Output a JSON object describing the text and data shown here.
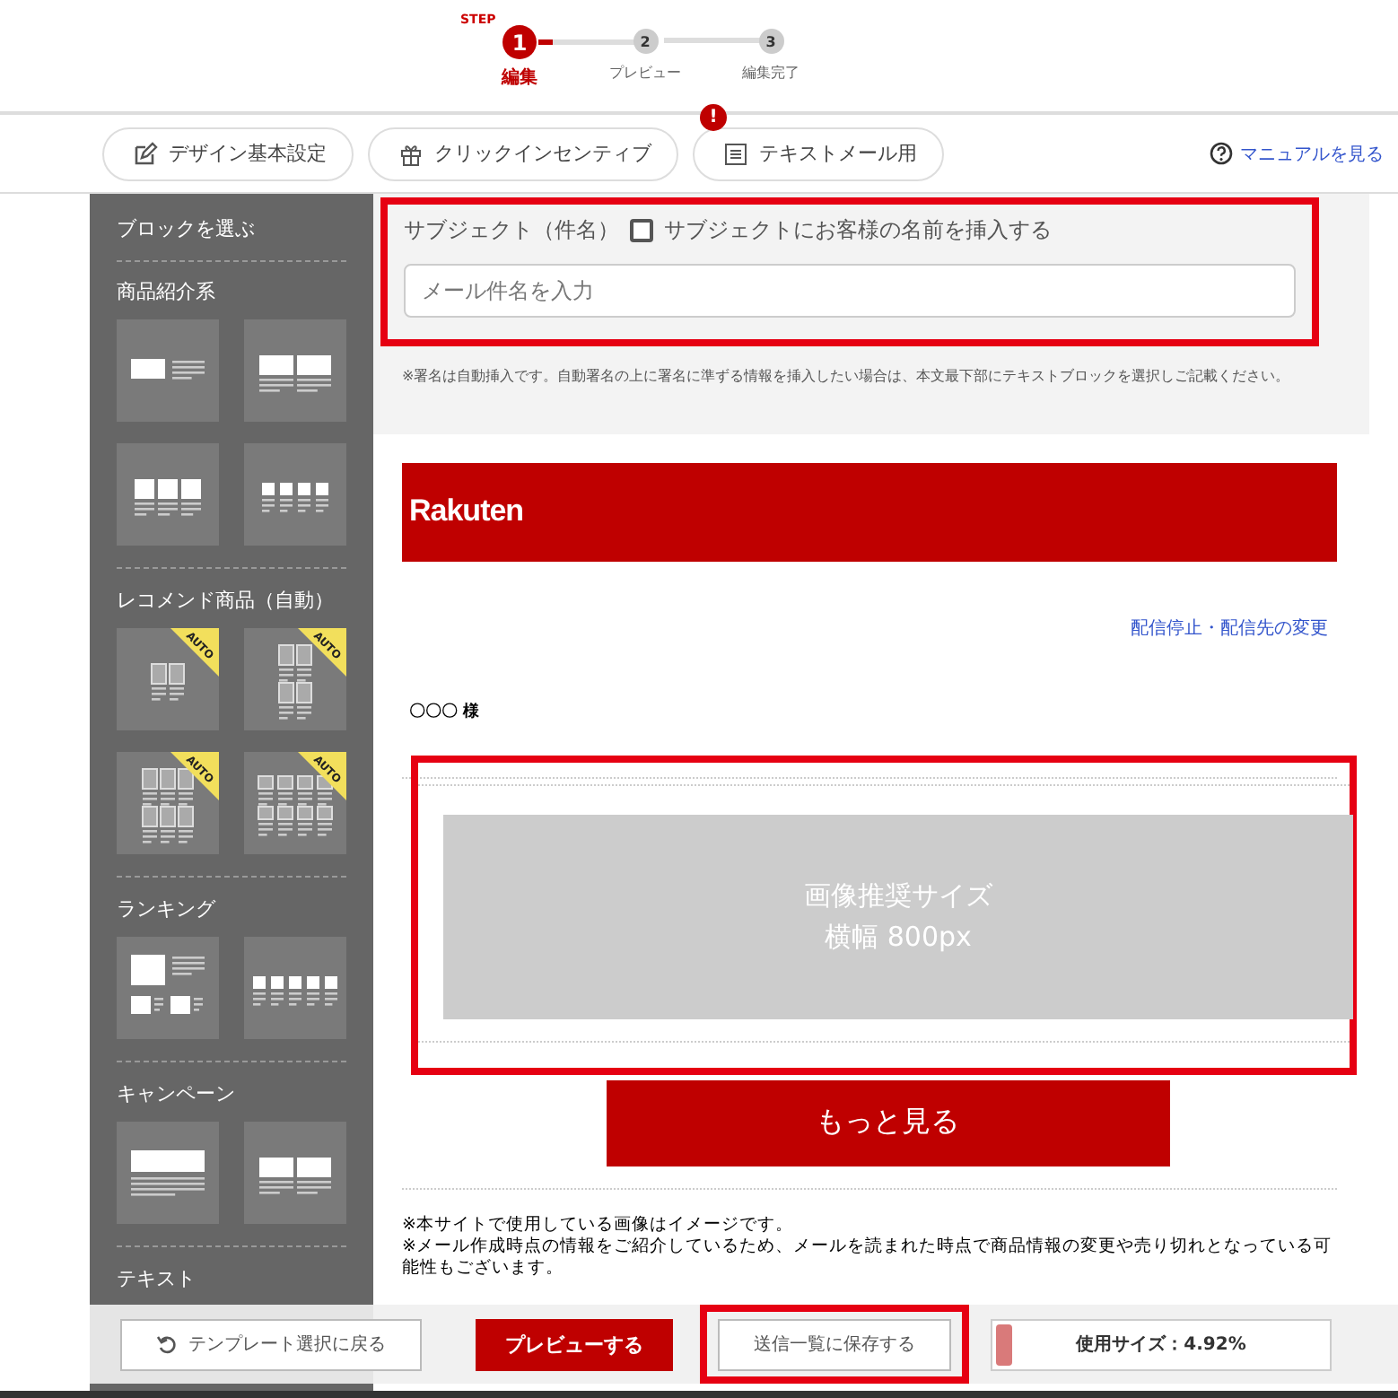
{
  "stepper": {
    "label": "STEP",
    "steps": [
      {
        "number": "1",
        "label": "編集",
        "selected": true
      },
      {
        "number": "2",
        "label": "プレビュー",
        "selected": false
      },
      {
        "number": "3",
        "label": "編集完了",
        "selected": false
      }
    ]
  },
  "toolbar": {
    "buttons": [
      {
        "label": "デザイン基本設定",
        "alert": false
      },
      {
        "label": "クリックインセンティブ",
        "alert": false
      },
      {
        "label": "テキストメール用",
        "alert": true
      }
    ],
    "alert_mark": "!",
    "help_link": "マニュアルを見る"
  },
  "sidebar": {
    "title": "ブロックを選ぶ",
    "sections": [
      {
        "title": "商品紹介系",
        "blocks": [
          {
            "kind": "image-left"
          },
          {
            "kind": "two"
          },
          {
            "kind": "three"
          },
          {
            "kind": "four"
          }
        ]
      },
      {
        "title": "レコメンド商品（自動）",
        "blocks": [
          {
            "kind": "rec-two",
            "badge": "AUTO"
          },
          {
            "kind": "rec-two-by-two",
            "badge": "AUTO"
          },
          {
            "kind": "rec-three-by-two",
            "badge": "AUTO"
          },
          {
            "kind": "rec-four-by-two",
            "badge": "AUTO"
          }
        ]
      },
      {
        "title": "ランキング",
        "blocks": [
          {
            "kind": "ranking"
          },
          {
            "kind": "five"
          }
        ]
      },
      {
        "title": "キャンペーン",
        "blocks": [
          {
            "kind": "banner"
          },
          {
            "kind": "two"
          }
        ]
      },
      {
        "title": "テキスト"
      }
    ]
  },
  "subject": {
    "label": "サブジェクト（件名）",
    "checkbox": {
      "label": "サブジェクトにお客様の名前を挿入する",
      "checked": false
    },
    "placeholder": "メール件名を入力",
    "highlighted": true,
    "note": "※署名は自動挿入です。自動署名の上に署名に準ずる情報を挿入したい場合は、本文最下部にテキストブロックを選択しご記載ください。"
  },
  "mail": {
    "logo": "Rakuten",
    "unsubscribe_link": "配信停止・配信先の変更",
    "greeting": "〇〇〇 様",
    "image_block": {
      "lines": [
        "画像推奨サイズ",
        "横幅 800px"
      ],
      "highlighted": true
    },
    "more_button": "もっと見る",
    "notes": [
      "※本サイトで使用している画像はイメージです。",
      "※メール作成時点の情報をご紹介しているため、メールを読まれた時点で商品情報の変更や売り切れとなっている可能性もございます。"
    ]
  },
  "footer": {
    "back_button": "テンプレート選択に戻る",
    "preview_button": "プレビューする",
    "save_button": {
      "label": "送信一覧に保存する",
      "highlighted": true
    },
    "usage": {
      "label": "使用サイズ：4.92%",
      "level": 0.05
    }
  }
}
